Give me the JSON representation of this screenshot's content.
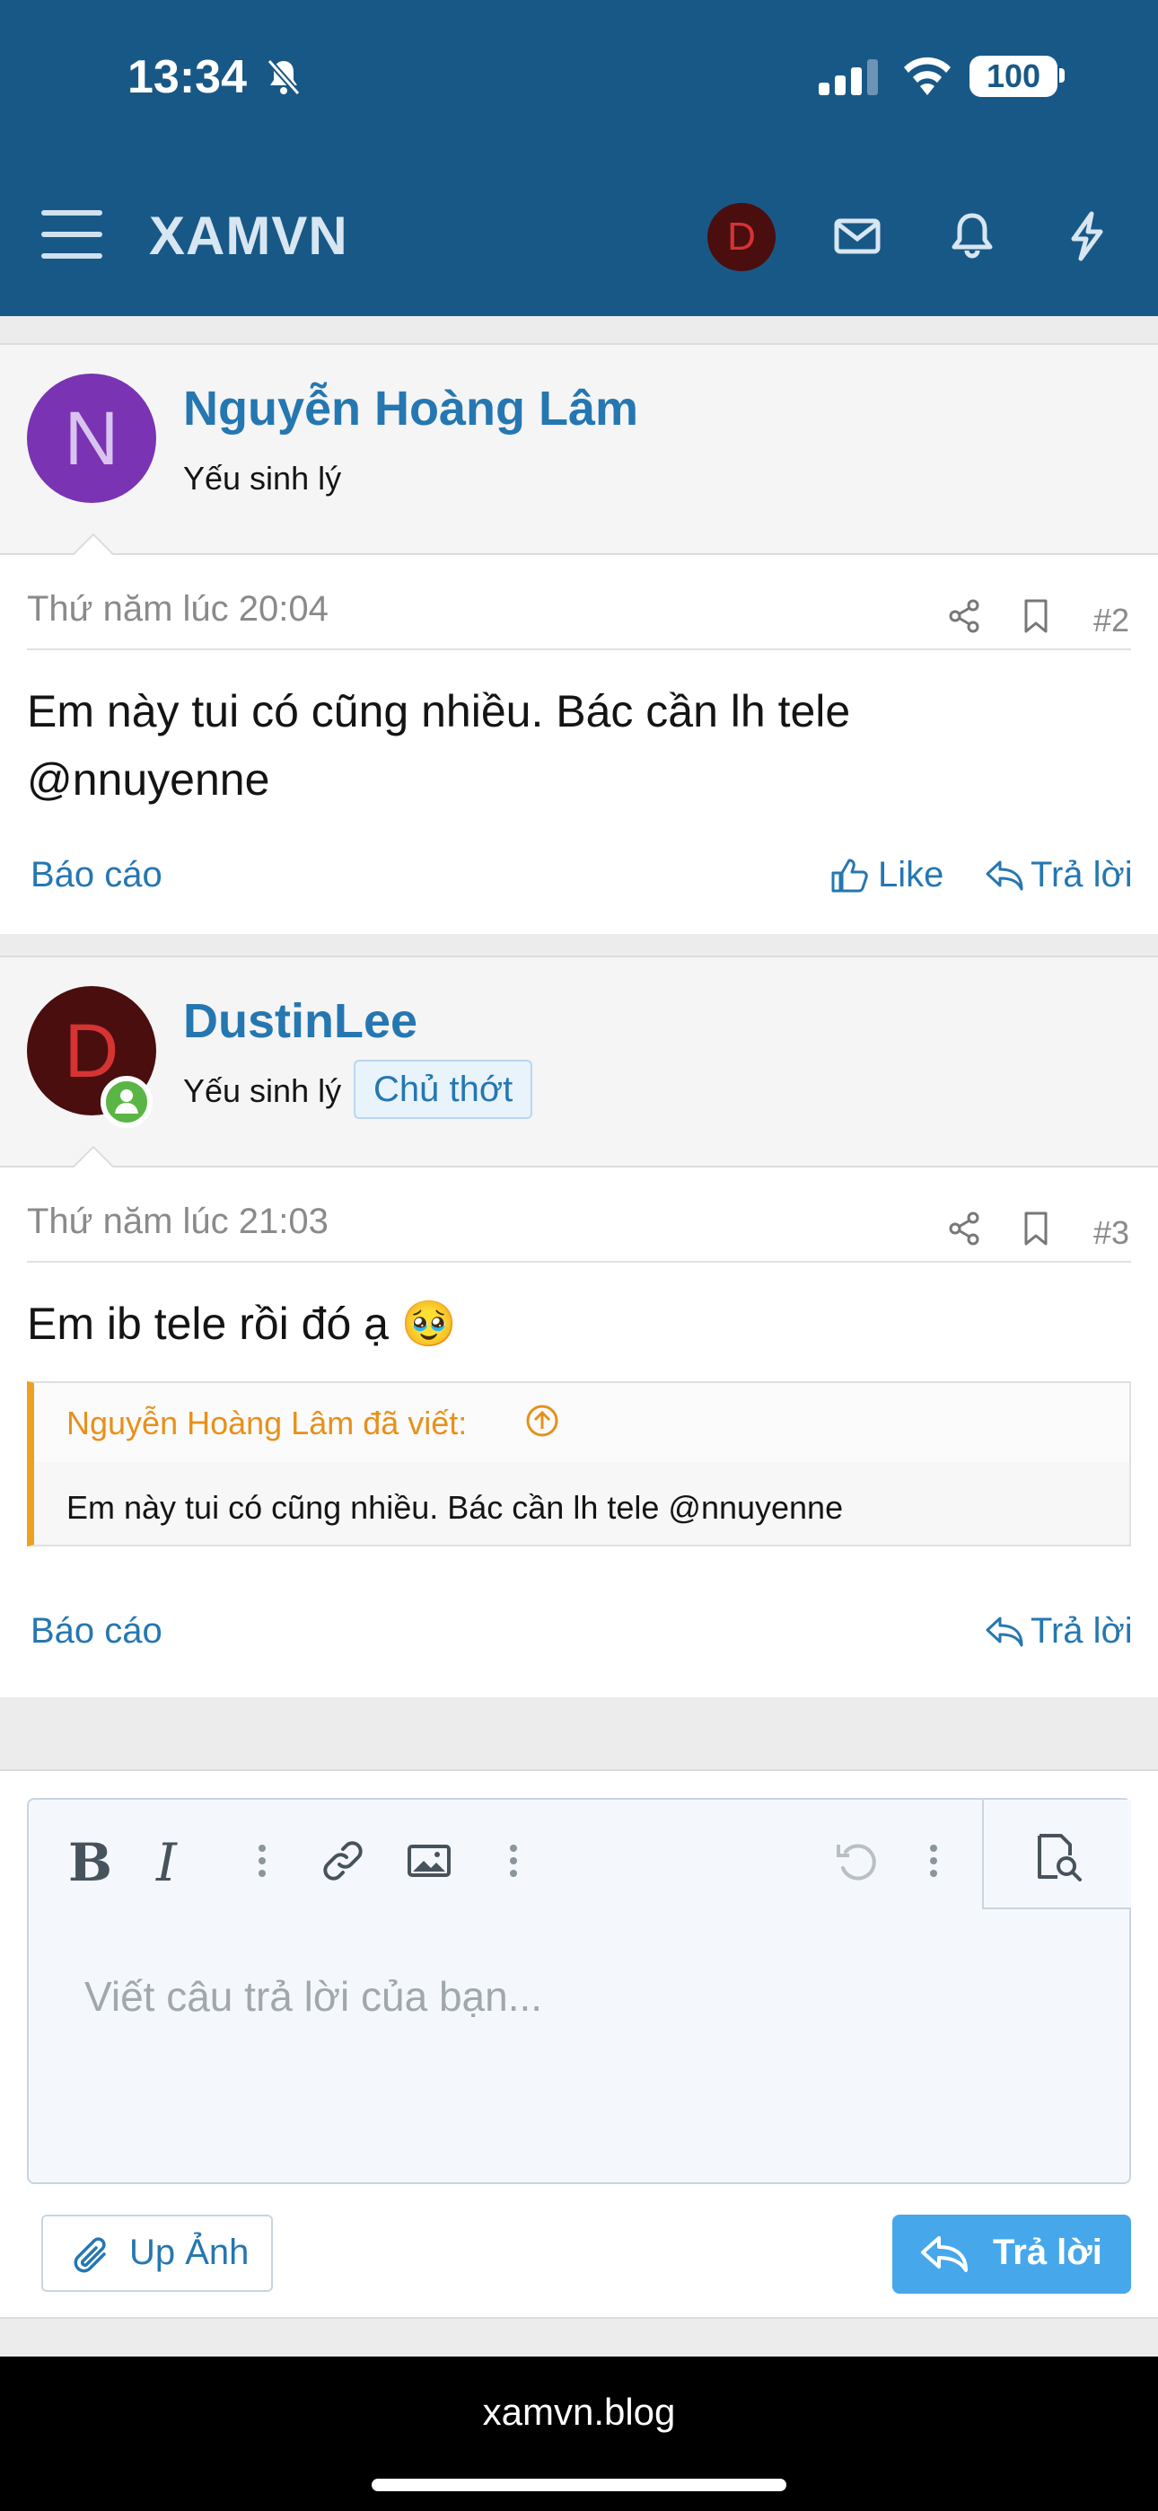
{
  "status_bar": {
    "time": "13:34",
    "battery": "100"
  },
  "header": {
    "site_title": "XAMVN",
    "avatar_initial": "D"
  },
  "posts": [
    {
      "author": "Nguyễn Hoàng Lâm",
      "avatar_initial": "N",
      "user_title": "Yếu sinh lý",
      "date": "Thứ năm lúc 20:04",
      "number": "#2",
      "message": "Em này tui có cũng nhiều. Bác cần lh tele @nnuyenne",
      "report_label": "Báo cáo",
      "like_label": "Like",
      "reply_label": "Trả lời"
    },
    {
      "author": "DustinLee",
      "avatar_initial": "D",
      "user_title": "Yếu sinh lý",
      "badge": "Chủ thớt",
      "date": "Thứ năm lúc 21:03",
      "number": "#3",
      "message": "Em ib tele rồi đó ạ 🥹",
      "quote_author": "Nguyễn Hoàng Lâm đã viết:",
      "quote_text": "Em này tui có cũng nhiều. Bác cần lh tele @nnuyenne",
      "report_label": "Báo cáo",
      "reply_label": "Trả lời"
    }
  ],
  "editor": {
    "bold": "B",
    "italic": "I",
    "placeholder": "Viết câu trả lời của bạn...",
    "upload_label": "Up Ảnh",
    "submit_label": "Trả lời"
  },
  "browser": {
    "url": "xamvn.blog"
  },
  "colors": {
    "header_bg": "#185886",
    "link": "#2577b1",
    "quote_accent": "#f0a020",
    "button": "#47a7eb"
  }
}
